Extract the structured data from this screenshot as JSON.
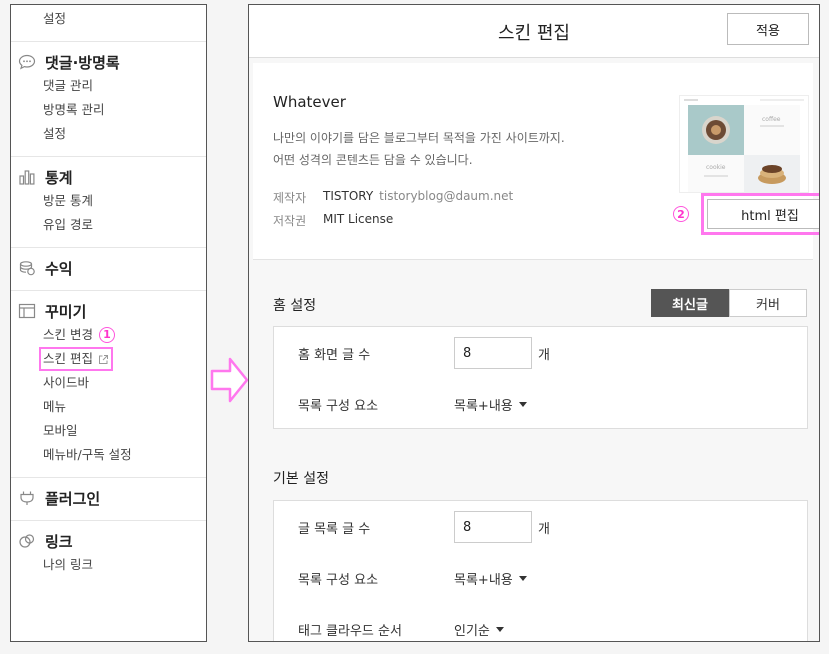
{
  "sidebar": {
    "top_item": "설정",
    "comments": {
      "title": "댓글·방명록",
      "items": [
        "댓글 관리",
        "방명록 관리",
        "설정"
      ]
    },
    "stats": {
      "title": "통계",
      "items": [
        "방문 통계",
        "유입 경로"
      ]
    },
    "revenue": {
      "title": "수익"
    },
    "decorate": {
      "title": "꾸미기",
      "skin_change": "스킨 변경",
      "badge1": "1",
      "skin_edit": "스킨 편집",
      "items": [
        "사이드바",
        "메뉴",
        "모바일",
        "메뉴바/구독 설정"
      ]
    },
    "plugin": {
      "title": "플러그인"
    },
    "link": {
      "title": "링크",
      "items": [
        "나의 링크"
      ]
    }
  },
  "main": {
    "title": "스킨 편집",
    "apply_label": "적용",
    "skin": {
      "name": "Whatever",
      "desc_line1": "나만의 이야기를 담은 블로그부터 목적을 가진 사이트까지.",
      "desc_line2": "어떤 성격의 콘텐츠든 담을 수 있습니다.",
      "maker_label": "제작자",
      "maker": "TISTORY",
      "maker_email": "tistoryblog@daum.net",
      "license_label": "저작권",
      "license": "MIT License",
      "thumb_text1": "coffee",
      "thumb_text2": "cookie"
    },
    "badge2": "2",
    "html_edit_label": "html 편집",
    "home": {
      "title": "홈 설정",
      "tab_latest": "최신글",
      "tab_cover": "커버",
      "post_count_label": "홈 화면 글 수",
      "post_count": "8",
      "unit": "개",
      "list_comp_label": "목록 구성 요소",
      "list_comp": "목록+내용"
    },
    "basic": {
      "title": "기본 설정",
      "post_count_label": "글 목록 글 수",
      "post_count": "8",
      "unit": "개",
      "list_comp_label": "목록 구성 요소",
      "list_comp": "목록+내용",
      "tag_order_label": "태그 클라우드 순서",
      "tag_order": "인기순"
    }
  },
  "colors": {
    "highlight": "#ff77ee",
    "active_tab": "#555555"
  }
}
